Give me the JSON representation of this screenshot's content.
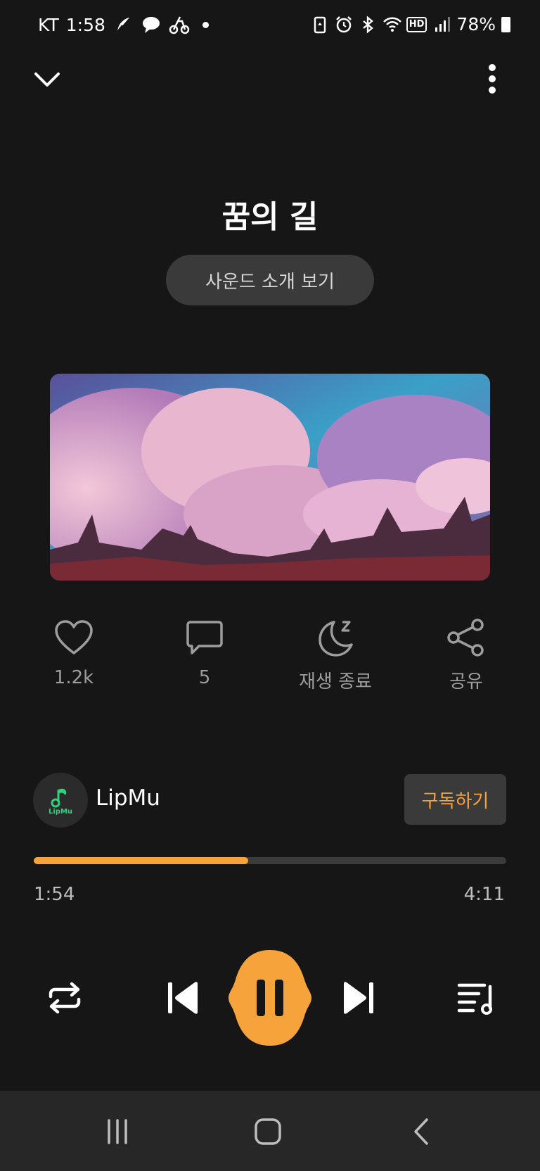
{
  "status_bar": {
    "carrier": "KT",
    "time": "1:58",
    "notification_icons": [
      "feather-icon",
      "chat-bubble-icon",
      "bike-icon"
    ],
    "system_icons": [
      "battery-saver-icon",
      "alarm-icon",
      "bluetooth-icon",
      "wifi-icon",
      "hd-voice-icon",
      "signal-icon"
    ],
    "hd_label": "HD",
    "battery": "78%"
  },
  "top_bar": {
    "back_icon": "chevron-down-icon",
    "more_icon": "more-vertical-icon"
  },
  "track": {
    "title": "꿈의 길",
    "intro_button": "사운드 소개 보기"
  },
  "actions": {
    "like": {
      "icon": "heart-icon",
      "label": "1.2k"
    },
    "comment": {
      "icon": "comment-icon",
      "label": "5"
    },
    "sleep": {
      "icon": "moon-sleep-icon",
      "label": "재생 종료"
    },
    "share": {
      "icon": "share-icon",
      "label": "공유"
    }
  },
  "channel": {
    "name": "LipMu",
    "avatar_text": "LipMu",
    "subscribe_label": "구독하기"
  },
  "player": {
    "current_time": "1:54",
    "total_time": "4:11",
    "progress_fraction": 0.454,
    "is_playing": true
  },
  "controls": {
    "repeat_icon": "repeat-icon",
    "prev_icon": "skip-previous-icon",
    "play_icon": "pause-icon",
    "next_icon": "skip-next-icon",
    "queue_icon": "playlist-icon"
  },
  "nav": {
    "recents_icon": "recents-icon",
    "home_icon": "home-icon",
    "back_icon": "back-icon"
  },
  "colors": {
    "background": "#161616",
    "accent": "#f6a33c",
    "button_bg": "#3a3a3a",
    "muted_text": "#9d9d9d"
  }
}
